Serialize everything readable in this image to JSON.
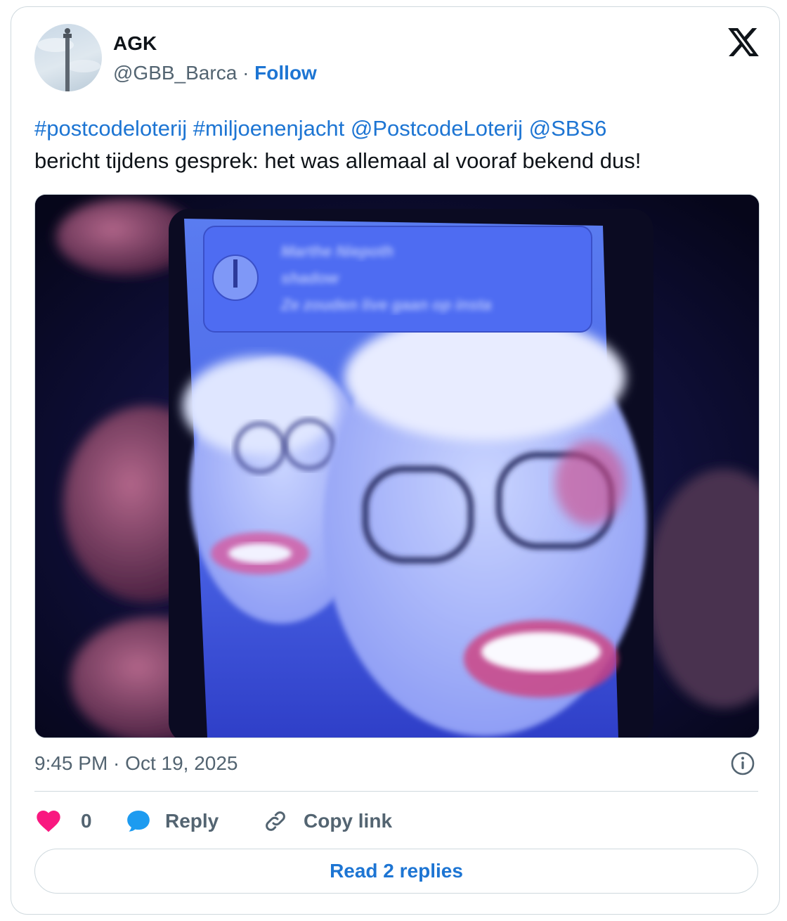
{
  "author": {
    "name": "AGK",
    "handle": "@GBB_Barca",
    "separator": "·",
    "follow_label": "Follow"
  },
  "tweet": {
    "hashtag_1": "#postcodeloterij",
    "hashtag_2": "#miljoenenjacht",
    "mention_1": "@PostcodeLoterij",
    "mention_2": "@SBS6",
    "body": "bericht tijdens gesprek: het was allemaal al vooraf bekend dus!"
  },
  "media": {
    "notification_sender": "Marthe Niepoth",
    "notification_app": "shadow",
    "notification_message": "Ze zouden live gaan op insta"
  },
  "timestamp": "9:45 PM · Oct 19, 2025",
  "actions": {
    "like_count": "0",
    "reply_label": "Reply",
    "copy_link_label": "Copy link"
  },
  "read_replies_label": "Read 2 replies",
  "icons": {
    "brand": "x-logo-icon",
    "info": "info-icon",
    "like": "heart-icon",
    "reply": "speech-bubble-icon",
    "copy": "link-icon"
  },
  "colors": {
    "link": "#1d75d3",
    "like": "#f91880",
    "reply": "#1d9bf0",
    "muted": "#536471",
    "border": "#cfd9de"
  }
}
